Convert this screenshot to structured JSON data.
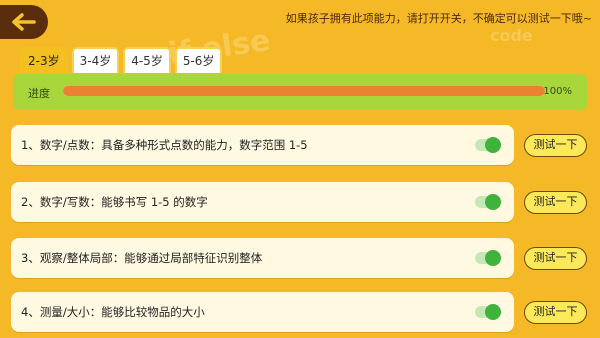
{
  "header": {
    "back_icon": "arrow-left-icon",
    "hint": "如果孩子拥有此项能力，请打开开关，不确定可以测试一下哦~"
  },
  "tabs": [
    {
      "label": "2-3岁",
      "active": true
    },
    {
      "label": "3-4岁",
      "active": false
    },
    {
      "label": "4-5岁",
      "active": false
    },
    {
      "label": "5-6岁",
      "active": false
    }
  ],
  "progress": {
    "label": "进度",
    "percent_text": "100%",
    "value": 1.0
  },
  "items": [
    {
      "text": "1、数字/点数：具备多种形式点数的能力，数字范围 1-5",
      "toggle_on": true,
      "button_label": "测试一下"
    },
    {
      "text": "2、数字/写数：能够书写 1-5 的数字",
      "toggle_on": true,
      "button_label": "测试一下"
    },
    {
      "text": "3、观察/整体局部：能够通过局部特征识别整体",
      "toggle_on": true,
      "button_label": "测试一下"
    },
    {
      "text": "4、测量/大小：能够比较物品的大小",
      "toggle_on": true,
      "button_label": "测试一下"
    }
  ],
  "colors": {
    "background": "#f5b826",
    "back_button": "#5a2d0c",
    "active_tab": "#f5c01f",
    "progress_panel": "#a9d63b",
    "progress_fill": "#ea8133",
    "toggle_on": "#3fb33c",
    "test_button": "#fbe95a"
  },
  "background_text": {
    "left": "if else",
    "right": "code"
  }
}
